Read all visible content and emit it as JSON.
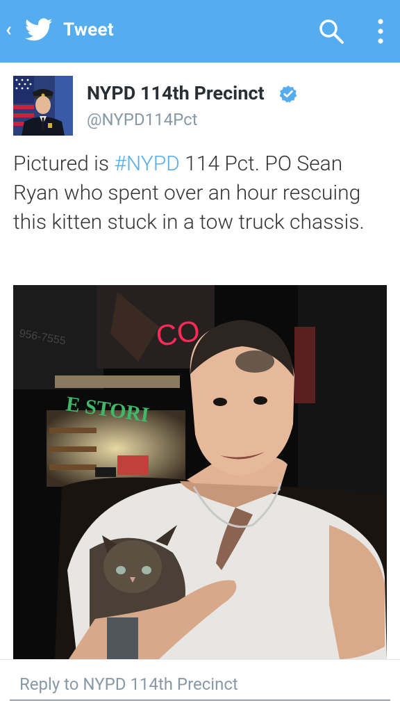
{
  "appbar": {
    "back_icon": "chevron-left",
    "logo": "twitter-bird",
    "title": "Tweet",
    "search_icon": "search",
    "menu_icon": "overflow-menu",
    "color": "#55acee"
  },
  "tweet": {
    "author_name": "NYPD 114th Precinct",
    "verified": true,
    "handle": "@NYPD114Pct",
    "text_before": "Pictured is ",
    "hashtag": "#NYPD",
    "text_after": " 114 Pct. PO Sean Ryan who spent over an hour rescuing this kitten stuck in a tow truck chassis.",
    "photo_sign": "CO",
    "photo_store_sign": "E STORI",
    "photo_phone": "956-7555"
  },
  "reply": {
    "placeholder": "Reply to NYPD 114th Precinct"
  }
}
